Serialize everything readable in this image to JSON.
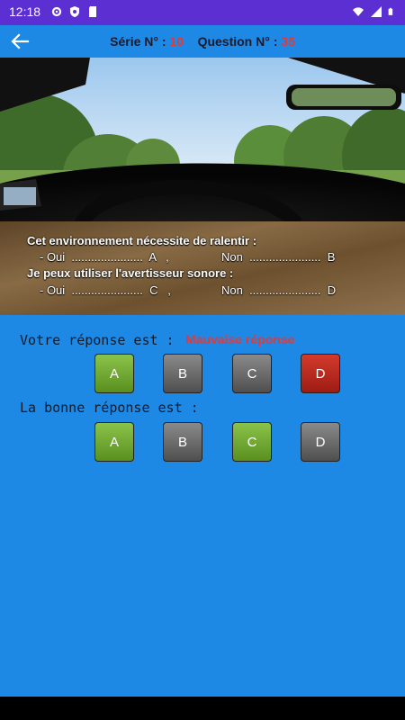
{
  "status_bar": {
    "time": "12:18",
    "left_icons": [
      "gear-icon",
      "shield-icon",
      "sd-card-icon"
    ],
    "right_icons": [
      "wifi-icon",
      "signal-icon",
      "battery-icon"
    ]
  },
  "header": {
    "serie_label": "Série N° :",
    "serie_value": "10",
    "question_label": "Question N° :",
    "question_value": "35"
  },
  "caption": {
    "line1": "Cet environnement nécessite de ralentir :",
    "line2_left": "- Oui  ......................  A   ,",
    "line2_right": "Non  ......................  B",
    "line3": "Je peux utiliser l'avertisseur sonore :",
    "line4_left": "- Oui  ......................  C   ,",
    "line4_right": "Non  ......................  D"
  },
  "user_answer": {
    "label": "Votre réponse est :",
    "verdict": "Mauvaise réponse",
    "buttons": [
      "A",
      "B",
      "C",
      "D"
    ]
  },
  "correct_answer": {
    "label": "La bonne réponse est :",
    "buttons": [
      "A",
      "B",
      "C",
      "D"
    ]
  },
  "colors": {
    "background": "#1e88e5",
    "status_bar": "#5b2fd1",
    "number_red": "#e53935",
    "selected_green": "#6fa82a",
    "unselected_gray": "#6b6b6b",
    "wrong_red": "#b3261e"
  }
}
